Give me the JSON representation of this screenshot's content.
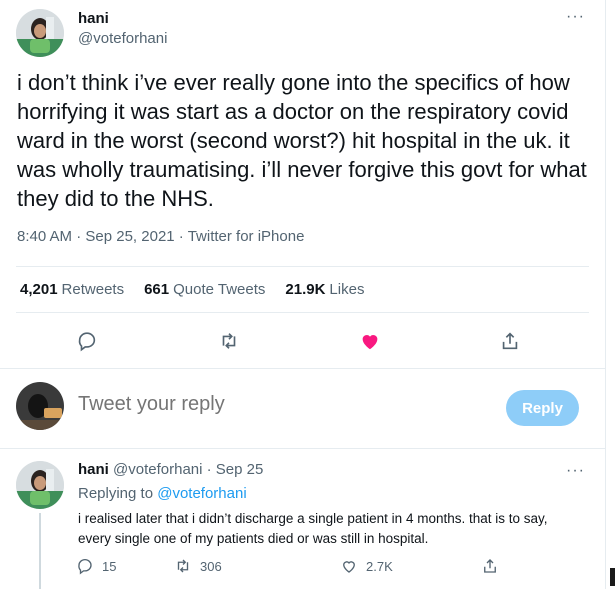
{
  "tweet": {
    "display_name": "hani",
    "handle": "@voteforhani",
    "more_icon": "···",
    "text": "i don’t think i’ve ever really gone into the specifics of how horrifying it was start as a doctor on the respiratory covid ward in the worst (second worst?) hit hospital in the uk. it was wholly traumatising. i’ll never forgive this govt for what they did to the NHS.",
    "time": "8:40 AM",
    "sep1": " · ",
    "date": "Sep 25, 2021",
    "sep2": " · ",
    "source": "Twitter for iPhone"
  },
  "stats": {
    "retweets_count": "4,201",
    "retweets_label": "Retweets",
    "quotes_count": "661",
    "quotes_label": "Quote Tweets",
    "likes_count": "21.9K",
    "likes_label": "Likes"
  },
  "actions": {
    "reply_icon": "comment-icon",
    "retweet_icon": "retweet-icon",
    "like_icon": "heart-filled-icon",
    "share_icon": "share-icon",
    "like_color": "#f91880"
  },
  "composer": {
    "placeholder": "Tweet your reply",
    "reply_button": "Reply",
    "button_color": "#8ecdf8"
  },
  "reply": {
    "display_name": "hani",
    "handle_date": "@voteforhani · Sep 25",
    "more_icon": "···",
    "replying_prefix": "Replying to",
    "replying_handle": "@voteforhani",
    "text": "i realised later that i didn’t discharge a single patient in 4 months. that is to say, every single one of my patients died or was still in hospital.",
    "reply_count": "15",
    "retweet_count": "306",
    "like_count": "2.7K",
    "link_color": "#1d9bf0"
  }
}
